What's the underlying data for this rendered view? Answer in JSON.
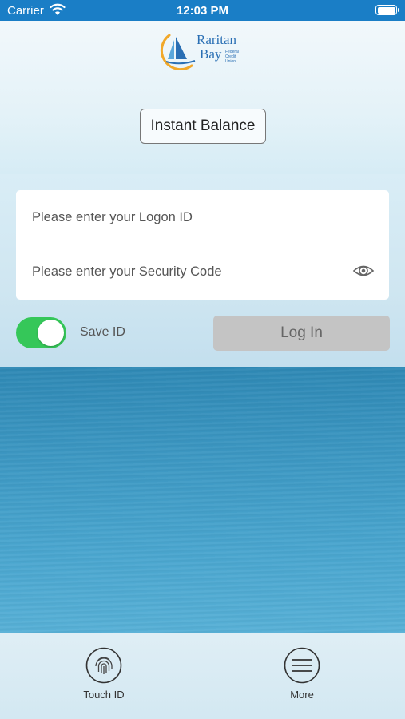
{
  "status_bar": {
    "carrier": "Carrier",
    "time": "12:03 PM"
  },
  "logo": {
    "line1": "Raritan",
    "line2": "Bay",
    "sub": "Federal Credit Union"
  },
  "instant_balance": {
    "label": "Instant Balance"
  },
  "login_form": {
    "logon_placeholder": "Please enter your Logon ID",
    "security_placeholder": "Please enter your Security Code",
    "save_id_label": "Save ID",
    "save_id_on": true,
    "login_label": "Log In"
  },
  "tab_bar": {
    "items": [
      {
        "label": "Touch ID",
        "icon": "fingerprint-icon"
      },
      {
        "label": "More",
        "icon": "menu-icon"
      }
    ]
  },
  "colors": {
    "status_bar": "#1a7ec6",
    "toggle_on": "#35c759",
    "login_disabled": "#c4c4c4"
  }
}
